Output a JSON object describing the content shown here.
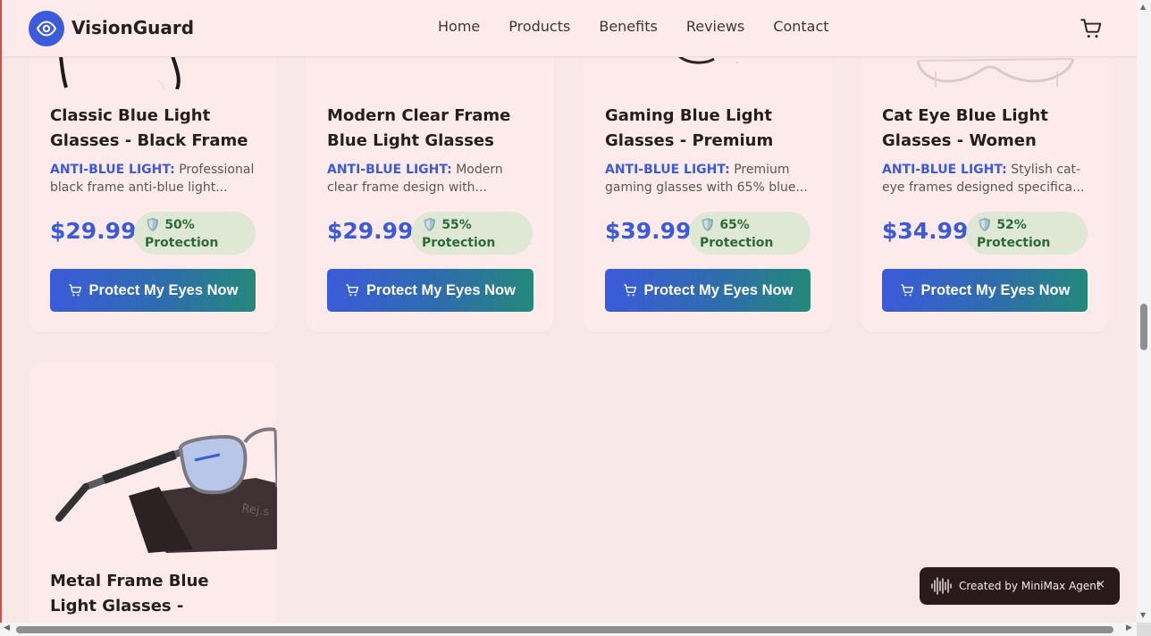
{
  "brand": {
    "name": "VisionGuard",
    "logo_icon": "eye-icon"
  },
  "nav": {
    "items": [
      "Home",
      "Products",
      "Benefits",
      "Reviews",
      "Contact"
    ],
    "cart_icon": "cart-icon"
  },
  "products": [
    {
      "title": "Classic Blue Light Glasses - Black Frame",
      "desc_tag": "ANTI-BLUE LIGHT:",
      "desc": "Professional black frame anti-blue light...",
      "price": "$29.99",
      "badge_icon": "🛡️",
      "badge": "50% Protection",
      "button": "Protect My Eyes Now"
    },
    {
      "title": "Modern Clear Frame Blue Light Glasses",
      "desc_tag": "ANTI-BLUE LIGHT:",
      "desc": "Modern clear frame design with...",
      "price": "$29.99",
      "badge_icon": "🛡️",
      "badge": "55% Protection",
      "button": "Protect My Eyes Now"
    },
    {
      "title": "Gaming Blue Light Glasses - Premium",
      "desc_tag": "ANTI-BLUE LIGHT:",
      "desc": "Premium gaming glasses with 65% blue...",
      "price": "$39.99",
      "badge_icon": "🛡️",
      "badge": "65% Protection",
      "button": "Protect My Eyes Now"
    },
    {
      "title": "Cat Eye Blue Light Glasses - Women",
      "desc_tag": "ANTI-BLUE LIGHT:",
      "desc": "Stylish cat-eye frames designed specifica...",
      "price": "$34.99",
      "badge_icon": "🛡️",
      "badge": "52% Protection",
      "button": "Protect My Eyes Now"
    },
    {
      "title": "Metal Frame Blue Light Glasses -"
    }
  ],
  "toast": {
    "text": "Created by MiniMax Agent",
    "close": "×"
  },
  "colors": {
    "accent": "#3b5bdb",
    "badge_bg": "#dfe8d5",
    "badge_text": "#2c6a39",
    "page_bg": "#f9e8e8"
  }
}
